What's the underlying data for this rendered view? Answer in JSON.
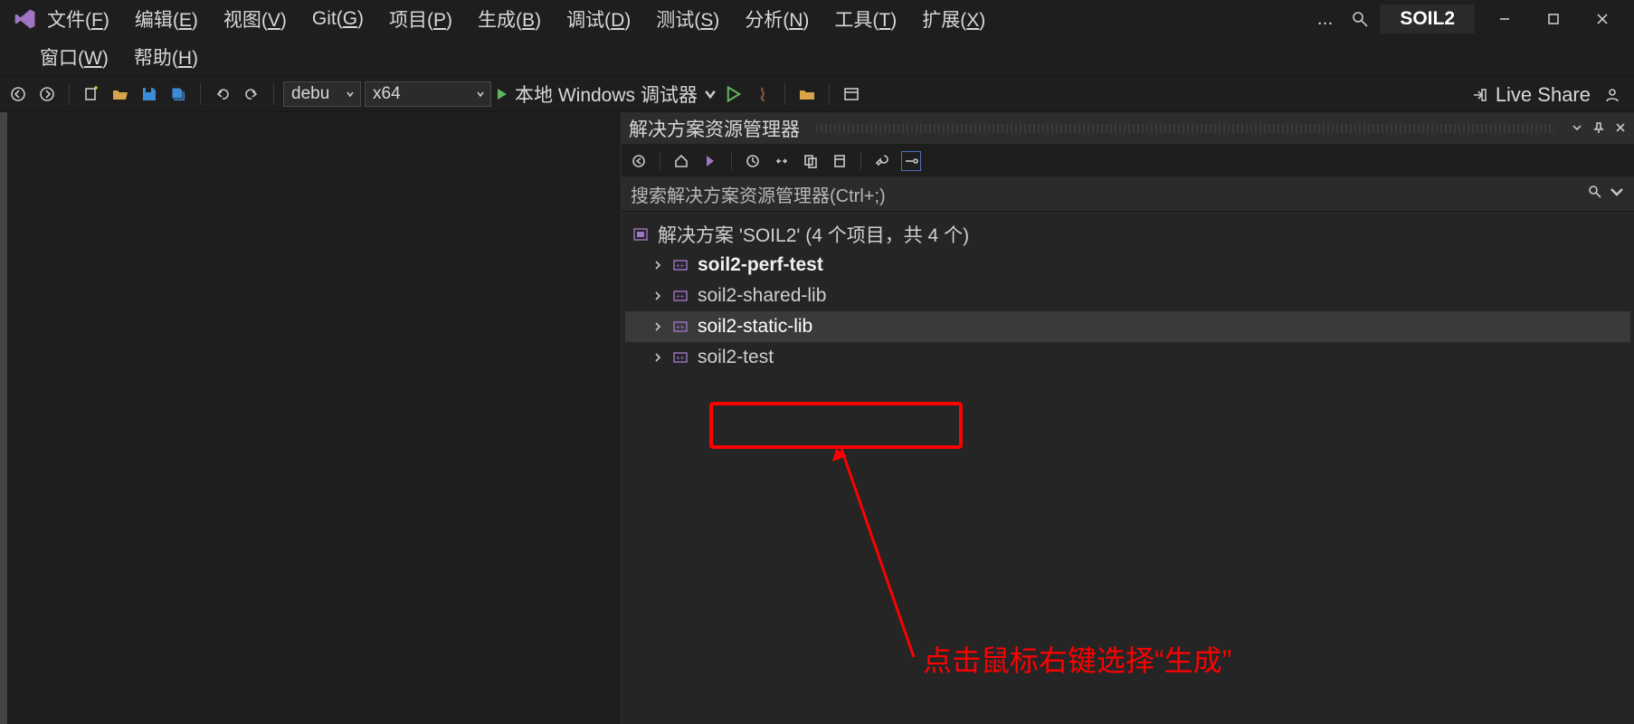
{
  "window": {
    "solution_title": "SOIL2"
  },
  "menu": {
    "items": [
      {
        "pre": "文件(",
        "u": "F",
        "post": ")"
      },
      {
        "pre": "编辑(",
        "u": "E",
        "post": ")"
      },
      {
        "pre": "视图(",
        "u": "V",
        "post": ")"
      },
      {
        "pre": "Git(",
        "u": "G",
        "post": ")"
      },
      {
        "pre": "项目(",
        "u": "P",
        "post": ")"
      },
      {
        "pre": "生成(",
        "u": "B",
        "post": ")"
      },
      {
        "pre": "调试(",
        "u": "D",
        "post": ")"
      },
      {
        "pre": "测试(",
        "u": "S",
        "post": ")"
      },
      {
        "pre": "分析(",
        "u": "N",
        "post": ")"
      },
      {
        "pre": "工具(",
        "u": "T",
        "post": ")"
      },
      {
        "pre": "扩展(",
        "u": "X",
        "post": ")"
      }
    ],
    "row2": [
      {
        "pre": "窗口(",
        "u": "W",
        "post": ")"
      },
      {
        "pre": "帮助(",
        "u": "H",
        "post": ")"
      }
    ],
    "ellipsis": "..."
  },
  "toolbar": {
    "config": "debu",
    "platform": "x64",
    "start_label": "本地 Windows 调试器",
    "live_share": "Live Share"
  },
  "panel": {
    "title": "解决方案资源管理器",
    "search_placeholder": "搜索解决方案资源管理器(Ctrl+;)",
    "solution_label": "解决方案 'SOIL2' (4 个项目，共 4 个)",
    "projects": [
      {
        "name": "soil2-perf-test",
        "bold": true,
        "selected": false
      },
      {
        "name": "soil2-shared-lib",
        "bold": false,
        "selected": false
      },
      {
        "name": "soil2-static-lib",
        "bold": false,
        "selected": true
      },
      {
        "name": "soil2-test",
        "bold": false,
        "selected": false
      }
    ]
  },
  "annotation": {
    "text": "点击鼠标右键选择“生成”"
  }
}
